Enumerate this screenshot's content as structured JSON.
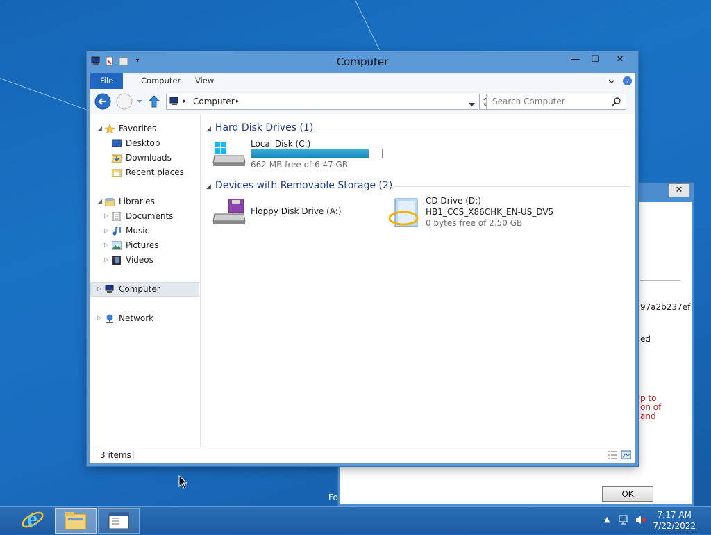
{
  "window": {
    "title": "Computer",
    "qat_dropdown": "▾",
    "minimize": "—",
    "maximize": "☐",
    "close": "✕"
  },
  "ribbon": {
    "tabs": [
      "File",
      "Computer",
      "View"
    ],
    "expand_icon": "chevron-down-icon",
    "help_icon": "help-icon"
  },
  "address": {
    "path": "Computer",
    "search_placeholder": "Search Computer"
  },
  "nav": {
    "favorites": "Favorites",
    "favorites_items": [
      "Desktop",
      "Downloads",
      "Recent places"
    ],
    "libraries": "Libraries",
    "library_items": [
      "Documents",
      "Music",
      "Pictures",
      "Videos"
    ],
    "computer": "Computer",
    "network": "Network"
  },
  "content": {
    "group1": "Hard Disk Drives (1)",
    "group2": "Devices with Removable Storage (2)",
    "local_disk": {
      "name": "Local Disk (C:)",
      "free": "662 MB free of 6.47 GB",
      "used_fraction": 0.9
    },
    "floppy": {
      "name": "Floppy Disk Drive (A:)"
    },
    "cd": {
      "name": "CD Drive (D:)",
      "label": "HB1_CCS_X86CHK_EN-US_DV5",
      "free": "0 bytes free of 2.50 GB"
    }
  },
  "status": {
    "items": "3 items"
  },
  "dialog": {
    "close": "✕",
    "text1": "97a2b237ef",
    "text2": "ed",
    "red_lines": [
      "p to",
      "on of",
      "and"
    ],
    "fo": "Fo",
    "ok": "OK"
  },
  "taskbar": {
    "time": "7:17 AM",
    "date": "7/22/2022"
  }
}
